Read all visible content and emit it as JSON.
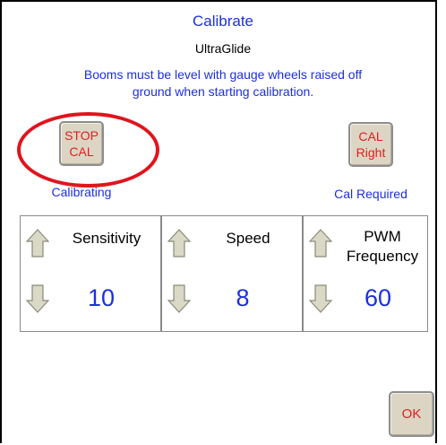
{
  "header": {
    "title": "Calibrate",
    "subtitle": "UltraGlide",
    "instructions_line1": "Booms must be level with gauge wheels raised off",
    "instructions_line2": "ground when starting calibration."
  },
  "calibration": {
    "left": {
      "button_line1": "STOP",
      "button_line2": "CAL",
      "status": "Calibrating"
    },
    "right": {
      "button_line1": "CAL",
      "button_line2": "Right",
      "status": "Cal Required"
    }
  },
  "params": [
    {
      "label_line1": "Sensitivity",
      "label_line2": "",
      "value": "10"
    },
    {
      "label_line1": "Speed",
      "label_line2": "",
      "value": "8"
    },
    {
      "label_line1": "PWM",
      "label_line2": "Frequency",
      "value": "60"
    }
  ],
  "footer": {
    "ok_label": "OK"
  },
  "colors": {
    "accent_blue": "#1c2fe0",
    "button_text_red": "#e01e1e",
    "highlight_red": "#e0141e",
    "button_face": "#ddd5c4",
    "arrow_fill": "#d9d9c6"
  },
  "icons": [
    "arrow-up-icon",
    "arrow-down-icon"
  ]
}
